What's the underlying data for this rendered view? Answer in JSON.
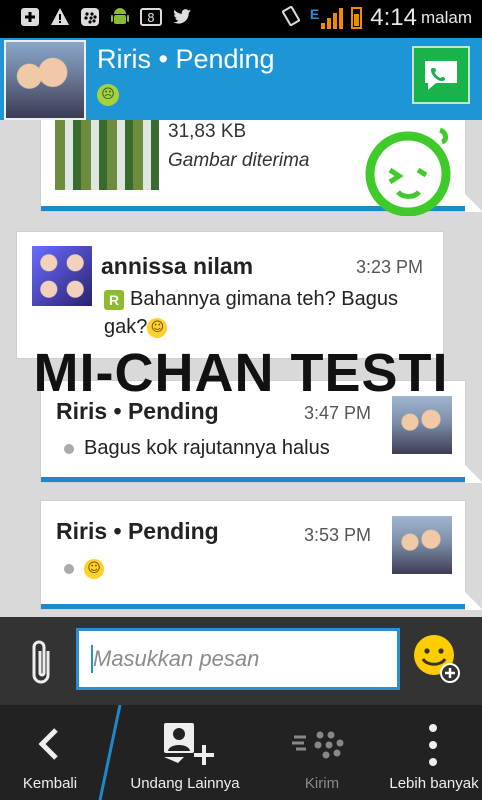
{
  "status_bar": {
    "time": "4:14",
    "ampm": "malam",
    "network": "E",
    "left_icons": [
      "plus-box-icon",
      "warning-icon",
      "blackberry-icon",
      "android-icon",
      "notification-count-icon",
      "twitter-icon"
    ],
    "notification_count": "8"
  },
  "header": {
    "title": "Riris • Pending",
    "status_emoji": "☹",
    "chat_icon": "chat-bubble-icon"
  },
  "messages": [
    {
      "type": "image",
      "file_size": "31,83 KB",
      "status": "Gambar diterima"
    },
    {
      "type": "incoming",
      "sender": "annissa nilam",
      "time": "3:23 PM",
      "badge": "R",
      "text": "Bahannya gimana teh? Bagus gak?",
      "emoji": "☺"
    },
    {
      "type": "outgoing",
      "sender": "Riris • Pending",
      "time": "3:47 PM",
      "text": "Bagus kok rajutannya halus"
    },
    {
      "type": "outgoing",
      "sender": "Riris • Pending",
      "time": "3:53 PM",
      "emoji": "☺"
    }
  ],
  "watermark": "MI-CHAN TESTI",
  "input": {
    "placeholder": "Masukkan pesan"
  },
  "actions": {
    "back": "Kembali",
    "invite": "Undang Lainnya",
    "send": "Kirim",
    "more": "Lebih banyak"
  },
  "colors": {
    "header": "#1e96d6",
    "accent": "#1e88c8",
    "status_orange": "#f08a00",
    "send_green": "#19b24b"
  }
}
